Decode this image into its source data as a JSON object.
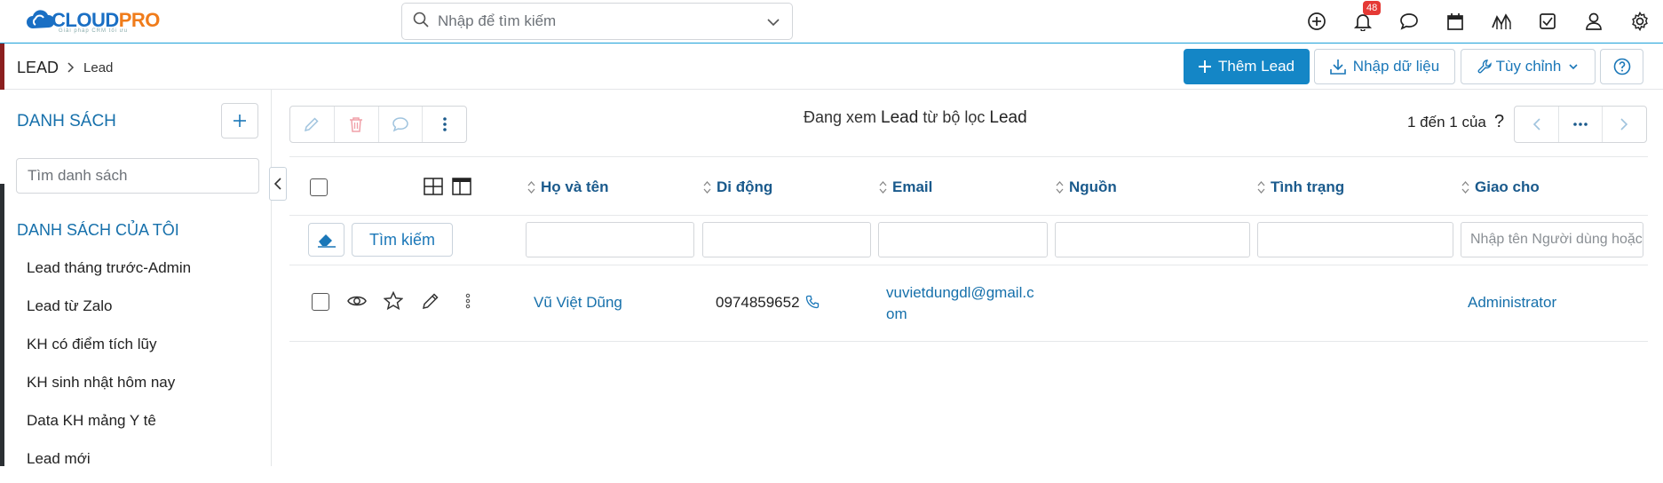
{
  "app": {
    "brand_main": "CLOUD",
    "brand_accent": "PRO",
    "tagline": "Giải pháp CRM tối ưu",
    "accent_color": "#1486c6"
  },
  "search": {
    "placeholder": "Nhập để tìm kiếm"
  },
  "topbar": {
    "icons": [
      "plus-circle-icon",
      "bell-icon",
      "chat-icon",
      "calendar-icon",
      "chart-icon",
      "checkbox-icon",
      "user-icon",
      "gear-icon"
    ],
    "notification_count": "48"
  },
  "breadcrumb": {
    "module": "LEAD",
    "page": "Lead"
  },
  "header_actions": {
    "add": "Thêm Lead",
    "import": "Nhập dữ liệu",
    "customize": "Tùy chỉnh"
  },
  "sidebar": {
    "title": "DANH SÁCH",
    "search_placeholder": "Tìm danh sách",
    "my_lists_title": "DANH SÁCH CỦA TÔI",
    "items": [
      "Lead tháng trước-Admin",
      "Lead từ Zalo",
      "KH có điểm tích lũy",
      "KH sinh nhật hôm nay",
      "Data KH mảng Y tê",
      "Lead mới"
    ]
  },
  "listview": {
    "viewing_prefix": "Đang xem ",
    "viewing_module": "Lead",
    "viewing_mid": " từ bộ lọc ",
    "viewing_filter": "Lead",
    "pager_text": "1 đến 1 của",
    "pager_unknown": "?"
  },
  "table": {
    "columns": [
      "Họ và tên",
      "Di động",
      "Email",
      "Nguồn",
      "Tình trạng",
      "Giao cho"
    ],
    "filter": {
      "search_label": "Tìm kiếm",
      "assignee_placeholder": "Nhập tên Người dùng hoặc Nhóm"
    },
    "rows": [
      {
        "name": "Vũ Việt Dũng",
        "mobile": "0974859652",
        "email_line1": "vuvietdungdl@gmail.c",
        "email_line2": "om",
        "source": "",
        "status": "",
        "assignee": "Administrator"
      }
    ]
  }
}
